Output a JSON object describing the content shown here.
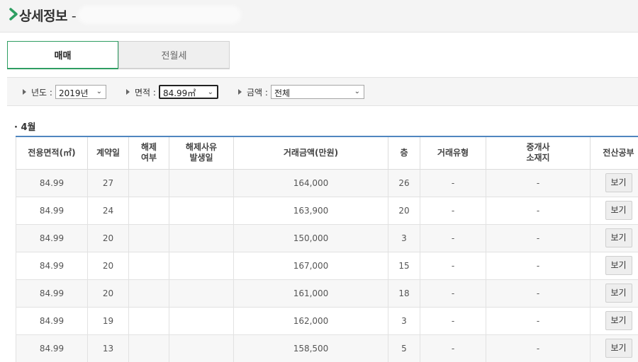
{
  "header": {
    "title": "상세정보",
    "separator": "-"
  },
  "tabs": [
    {
      "label": "매매",
      "active": true
    },
    {
      "label": "전월세",
      "active": false
    }
  ],
  "filters": {
    "year": {
      "label": "년도 :",
      "value": "2019년"
    },
    "area": {
      "label": "면적 :",
      "value": "84.99㎡"
    },
    "price": {
      "label": "금액 :",
      "value": "전체"
    }
  },
  "section": {
    "month": "4월",
    "bullet": "·"
  },
  "table": {
    "headers": [
      "전용면적(㎡)",
      "계약일",
      "해제\n여부",
      "해제사유\n발생일",
      "거래금액(만원)",
      "층",
      "거래유형",
      "중개사\n소재지",
      "전산공부"
    ],
    "button_label": "보기",
    "rows": [
      {
        "area": "84.99",
        "day": "27",
        "cancel": "",
        "cancel_date": "",
        "price": "164,000",
        "floor": "26",
        "type": "-",
        "broker": "-"
      },
      {
        "area": "84.99",
        "day": "24",
        "cancel": "",
        "cancel_date": "",
        "price": "163,900",
        "floor": "20",
        "type": "-",
        "broker": "-"
      },
      {
        "area": "84.99",
        "day": "20",
        "cancel": "",
        "cancel_date": "",
        "price": "150,000",
        "floor": "3",
        "type": "-",
        "broker": "-"
      },
      {
        "area": "84.99",
        "day": "20",
        "cancel": "",
        "cancel_date": "",
        "price": "167,000",
        "floor": "15",
        "type": "-",
        "broker": "-"
      },
      {
        "area": "84.99",
        "day": "20",
        "cancel": "",
        "cancel_date": "",
        "price": "161,000",
        "floor": "18",
        "type": "-",
        "broker": "-"
      },
      {
        "area": "84.99",
        "day": "19",
        "cancel": "",
        "cancel_date": "",
        "price": "162,000",
        "floor": "3",
        "type": "-",
        "broker": "-"
      },
      {
        "area": "84.99",
        "day": "13",
        "cancel": "",
        "cancel_date": "",
        "price": "158,500",
        "floor": "5",
        "type": "-",
        "broker": "-"
      }
    ]
  },
  "colors": {
    "accent_green": "#2e9e62",
    "header_rule_blue": "#4f86bf"
  }
}
